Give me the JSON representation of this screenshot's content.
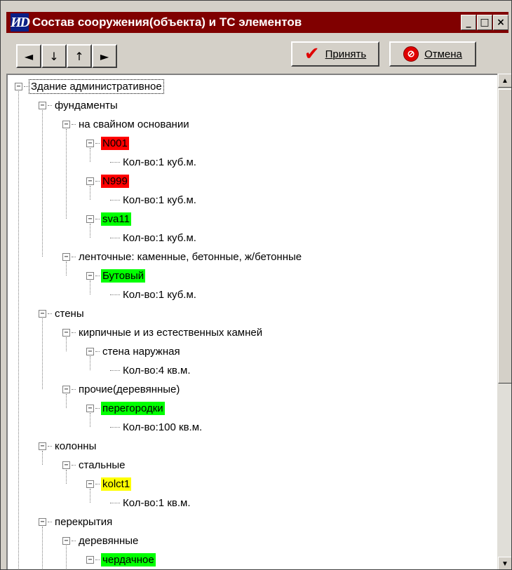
{
  "window": {
    "title": "Состав сооружения(объекта) и ТС элементов",
    "app_icon": "ИD",
    "minimize": "_",
    "maximize": "□",
    "close": "×"
  },
  "toolbar": {
    "nav_left": "◄",
    "nav_down": "↓",
    "nav_up": "↑",
    "nav_right": "►",
    "accept_label": "Принять",
    "cancel_label": "Отмена"
  },
  "colors": {
    "red": "#ff0000",
    "green": "#00ff00",
    "yellow": "#ffff00"
  },
  "tree": [
    {
      "text": "Здание административное",
      "level": 0,
      "kind": "node",
      "hl": "selected"
    },
    {
      "text": "фундаменты",
      "level": 1,
      "kind": "node"
    },
    {
      "text": "на свайном основании",
      "level": 2,
      "kind": "node"
    },
    {
      "text": "N001",
      "level": 3,
      "kind": "node",
      "hl": "red"
    },
    {
      "text": "Кол-во:1 куб.м.",
      "level": 4,
      "kind": "leaf"
    },
    {
      "text": "N999",
      "level": 3,
      "kind": "node",
      "hl": "red"
    },
    {
      "text": "Кол-во:1 куб.м.",
      "level": 4,
      "kind": "leaf"
    },
    {
      "text": "sva11",
      "level": 3,
      "kind": "node",
      "hl": "green"
    },
    {
      "text": "Кол-во:1 куб.м.",
      "level": 4,
      "kind": "leaf"
    },
    {
      "text": "ленточные: каменные, бетонные, ж/бетонные",
      "level": 2,
      "kind": "node"
    },
    {
      "text": "Бутовый",
      "level": 3,
      "kind": "node",
      "hl": "green"
    },
    {
      "text": "Кол-во:1 куб.м.",
      "level": 4,
      "kind": "leaf"
    },
    {
      "text": "стены",
      "level": 1,
      "kind": "node"
    },
    {
      "text": "кирпичные и из естественных камней",
      "level": 2,
      "kind": "node"
    },
    {
      "text": "стена наружная",
      "level": 3,
      "kind": "node"
    },
    {
      "text": "Кол-во:4 кв.м.",
      "level": 4,
      "kind": "leaf"
    },
    {
      "text": "прочие(деревянные)",
      "level": 2,
      "kind": "node"
    },
    {
      "text": "перегородки",
      "level": 3,
      "kind": "node",
      "hl": "green"
    },
    {
      "text": "Кол-во:100 кв.м.",
      "level": 4,
      "kind": "leaf"
    },
    {
      "text": "колонны",
      "level": 1,
      "kind": "node"
    },
    {
      "text": "стальные",
      "level": 2,
      "kind": "node"
    },
    {
      "text": "kolct1",
      "level": 3,
      "kind": "node",
      "hl": "yellow"
    },
    {
      "text": "Кол-во:1 кв.м.",
      "level": 4,
      "kind": "leaf"
    },
    {
      "text": "перекрытия",
      "level": 1,
      "kind": "node"
    },
    {
      "text": "деревянные",
      "level": 2,
      "kind": "node"
    },
    {
      "text": "чердачное",
      "level": 3,
      "kind": "node",
      "hl": "green"
    }
  ]
}
